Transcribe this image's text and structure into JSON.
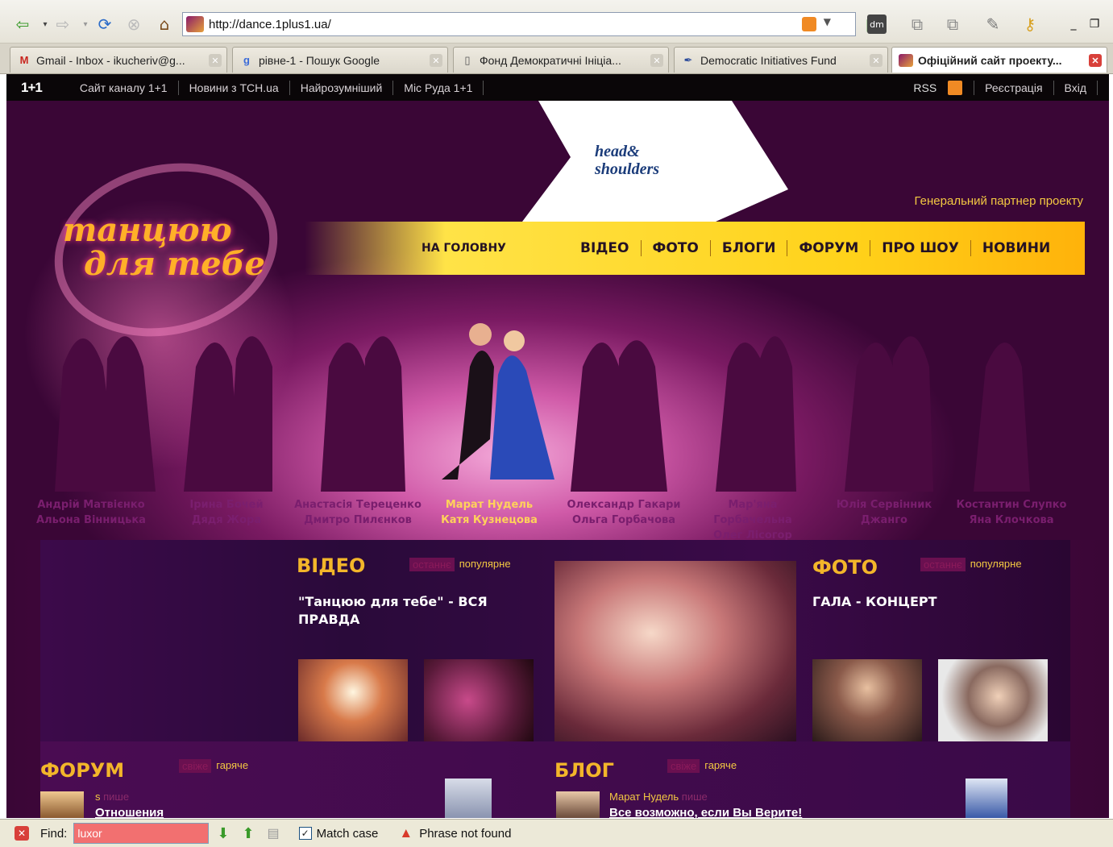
{
  "browser": {
    "url": "http://dance.1plus1.ua/",
    "tabs": [
      {
        "label": "Gmail - Inbox - ikucheriv@g...",
        "icon": "gmail-icon"
      },
      {
        "label": "рівне-1 - Пошук Google",
        "icon": "google-icon"
      },
      {
        "label": "Фонд Демократичні Ініціа...",
        "icon": "page-icon"
      },
      {
        "label": "Democratic Initiatives Fund",
        "icon": "pen-icon"
      },
      {
        "label": "Офіційний сайт проекту...",
        "icon": "site-favicon",
        "active": true
      }
    ]
  },
  "site_nav": {
    "logo": "1+1",
    "links": [
      "Сайт каналу 1+1",
      "Новини з ТСН.ua",
      "Найрозумніший",
      "Міс Руда 1+1"
    ],
    "rss": "RSS",
    "register": "Реєстрація",
    "login": "Вхід"
  },
  "hero": {
    "sponsor_logo_line1": "head&",
    "sponsor_logo_line2": "shoulders",
    "partner_text": "Генеральний партнер проекту",
    "show_logo_line1": "танцюю",
    "show_logo_line2": "для тебе",
    "menu_home": "НА ГОЛОВНУ",
    "menu": [
      "ВІДЕО",
      "ФОТО",
      "БЛОГИ",
      "ФОРУМ",
      "ПРО ШОУ",
      "НОВИНИ"
    ],
    "couples": [
      {
        "line1": "Андрій Матвієнко",
        "line2": "Альона Вінницька"
      },
      {
        "line1": "Ірина Бочей",
        "line2": "Дядя Жора"
      },
      {
        "line1": "Анастасія Тереценко",
        "line2": "Дмитро Пилєнков"
      },
      {
        "line1": "Марат Нудель",
        "line2": "Катя Кузнецова",
        "highlight": true
      },
      {
        "line1": "Олександр Гакари",
        "line2": "Ольга Горбачова"
      },
      {
        "line1": "Мар'яна Горбачельна",
        "line2": "Олег Лісогор"
      },
      {
        "line1": "Юлія Сервінник",
        "line2": "Джанго"
      },
      {
        "line1": "Костантин Слупко",
        "line2": "Яна Клочкова"
      }
    ]
  },
  "video": {
    "title": "ВІДЕО",
    "tab_latest": "останнє",
    "tab_popular": "популярне",
    "headline": "\"Танцюю для тебе\" - ВСЯ ПРАВДА"
  },
  "photo": {
    "title": "ФОТО",
    "tab_latest": "останнє",
    "tab_popular": "популярне",
    "headline": "ГАЛА - КОНЦЕРТ"
  },
  "forum": {
    "title": "ФОРУМ",
    "tab_fresh": "свіже",
    "tab_hot": "гаряче",
    "author": "s",
    "writes": "пише",
    "post_title": "Отношения"
  },
  "blog": {
    "title": "БЛОГ",
    "tab_fresh": "свіже",
    "tab_hot": "гаряче",
    "author": "Марат Нудель",
    "writes": "пише",
    "post_title": "Все возможно, если Вы Верите!"
  },
  "findbar": {
    "label": "Find:",
    "value": "luxor",
    "match_case": "Match case",
    "status": "Phrase not found"
  },
  "colors": {
    "accent_gold": "#f3b62a",
    "site_bg": "#3a0636",
    "menu_yellow": "#ffd21a"
  }
}
